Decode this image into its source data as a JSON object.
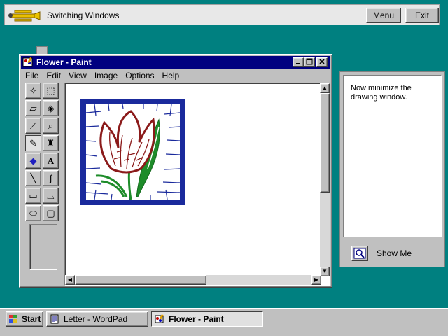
{
  "tutorial": {
    "title": "Switching Windows",
    "menu_label": "Menu",
    "exit_label": "Exit"
  },
  "paint_window": {
    "title": "Flower - Paint",
    "menu": [
      {
        "label": "File"
      },
      {
        "label": "Edit"
      },
      {
        "label": "View"
      },
      {
        "label": "Image"
      },
      {
        "label": "Options"
      },
      {
        "label": "Help"
      }
    ],
    "tools": [
      {
        "icon": "free-form-select-icon",
        "glyph": "✧"
      },
      {
        "icon": "select-icon",
        "glyph": "⬚"
      },
      {
        "icon": "eraser-icon",
        "glyph": "▱"
      },
      {
        "icon": "fill-with-color-icon",
        "glyph": "◈"
      },
      {
        "icon": "pick-color-icon",
        "glyph": "⟋"
      },
      {
        "icon": "magnifier-icon",
        "glyph": "⌕"
      },
      {
        "icon": "pencil-icon",
        "glyph": "✎"
      },
      {
        "icon": "brush-icon",
        "glyph": "♜"
      },
      {
        "icon": "airbrush-icon",
        "glyph": "◆"
      },
      {
        "icon": "text-icon",
        "glyph": "A"
      },
      {
        "icon": "line-icon",
        "glyph": "╲"
      },
      {
        "icon": "curve-icon",
        "glyph": "∫"
      },
      {
        "icon": "rectangle-icon",
        "glyph": "▭"
      },
      {
        "icon": "polygon-icon",
        "glyph": "⏢"
      },
      {
        "icon": "ellipse-icon",
        "glyph": "⬭"
      },
      {
        "icon": "rounded-rectangle-icon",
        "glyph": "▢"
      }
    ],
    "selected_tool": "pencil-icon"
  },
  "instruction": {
    "text": "Now minimize the drawing window.",
    "show_me_label": "Show Me"
  },
  "taskbar": {
    "start_label": "Start",
    "tasks": [
      {
        "label": "Letter - WordPad",
        "active": false
      },
      {
        "label": "Flower - Paint",
        "active": true
      }
    ]
  },
  "colors": {
    "desktop": "#008080",
    "title_active": "#000080",
    "picture_border": "#1a2a9c",
    "tulip_red": "#8b1a1a",
    "leaf_green": "#1e8c2a"
  }
}
